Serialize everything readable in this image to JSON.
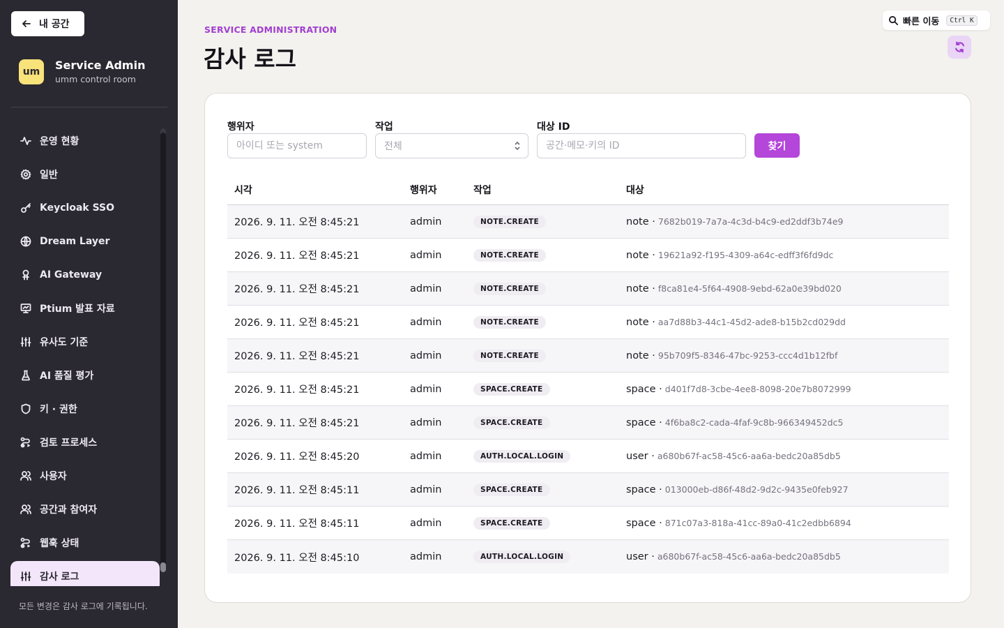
{
  "sidebar": {
    "back_label": "내 공간",
    "brand": {
      "logo": "um",
      "title": "Service Admin",
      "subtitle": "umm control room"
    },
    "items": [
      {
        "label": "운영 현황",
        "icon": "activity-icon"
      },
      {
        "label": "일반",
        "icon": "gear-icon"
      },
      {
        "label": "Keycloak SSO",
        "icon": "key-icon"
      },
      {
        "label": "Dream Layer",
        "icon": "layers-icon"
      },
      {
        "label": "AI Gateway",
        "icon": "gateway-icon"
      },
      {
        "label": "Ptium 발표 자료",
        "icon": "presentation-icon"
      },
      {
        "label": "유사도 기준",
        "icon": "sliders-icon"
      },
      {
        "label": "AI 품질 평가",
        "icon": "flask-icon"
      },
      {
        "label": "키 · 권한",
        "icon": "shield-icon"
      },
      {
        "label": "검토 프로세스",
        "icon": "workflow-icon"
      },
      {
        "label": "사용자",
        "icon": "users-icon"
      },
      {
        "label": "공간과 참여자",
        "icon": "users-icon"
      },
      {
        "label": "웹훅 상태",
        "icon": "webhook-icon"
      },
      {
        "label": "감사 로그",
        "icon": "sliders-icon",
        "active": true
      }
    ],
    "footer": "모든 변경은 감사 로그에 기록됩니다."
  },
  "header": {
    "eyebrow": "SERVICE ADMINISTRATION",
    "title": "감사 로그",
    "quick_nav": {
      "label": "빠른 이동",
      "shortcut": "Ctrl K"
    }
  },
  "filters": {
    "actor": {
      "label": "행위자",
      "placeholder": "아이디 또는 system"
    },
    "action": {
      "label": "작업",
      "value": "전체"
    },
    "target": {
      "label": "대상 ID",
      "placeholder": "공간·메모·키의 ID"
    },
    "search_label": "찾기"
  },
  "table": {
    "headers": {
      "time": "시각",
      "actor": "행위자",
      "action": "작업",
      "target": "대상"
    },
    "rows": [
      {
        "time": "2026. 9. 11. 오전 8:45:21",
        "actor": "admin",
        "action": "NOTE.CREATE",
        "kind": "note ·",
        "id": "7682b019-7a7a-4c3d-b4c9-ed2ddf3b74e9"
      },
      {
        "time": "2026. 9. 11. 오전 8:45:21",
        "actor": "admin",
        "action": "NOTE.CREATE",
        "kind": "note ·",
        "id": "19621a92-f195-4309-a64c-edff3f6fd9dc"
      },
      {
        "time": "2026. 9. 11. 오전 8:45:21",
        "actor": "admin",
        "action": "NOTE.CREATE",
        "kind": "note ·",
        "id": "f8ca81e4-5f64-4908-9ebd-62a0e39bd020"
      },
      {
        "time": "2026. 9. 11. 오전 8:45:21",
        "actor": "admin",
        "action": "NOTE.CREATE",
        "kind": "note ·",
        "id": "aa7d88b3-44c1-45d2-ade8-b15b2cd029dd"
      },
      {
        "time": "2026. 9. 11. 오전 8:45:21",
        "actor": "admin",
        "action": "NOTE.CREATE",
        "kind": "note ·",
        "id": "95b709f5-8346-47bc-9253-ccc4d1b12fbf"
      },
      {
        "time": "2026. 9. 11. 오전 8:45:21",
        "actor": "admin",
        "action": "SPACE.CREATE",
        "kind": "space ·",
        "id": "d401f7d8-3cbe-4ee8-8098-20e7b8072999"
      },
      {
        "time": "2026. 9. 11. 오전 8:45:21",
        "actor": "admin",
        "action": "SPACE.CREATE",
        "kind": "space ·",
        "id": "4f6ba8c2-cada-4faf-9c8b-966349452dc5"
      },
      {
        "time": "2026. 9. 11. 오전 8:45:20",
        "actor": "admin",
        "action": "AUTH.LOCAL.LOGIN",
        "kind": "user ·",
        "id": "a680b67f-ac58-45c6-aa6a-bedc20a85db5"
      },
      {
        "time": "2026. 9. 11. 오전 8:45:11",
        "actor": "admin",
        "action": "SPACE.CREATE",
        "kind": "space ·",
        "id": "013000eb-d86f-48d2-9d2c-9435e0feb927"
      },
      {
        "time": "2026. 9. 11. 오전 8:45:11",
        "actor": "admin",
        "action": "SPACE.CREATE",
        "kind": "space ·",
        "id": "871c07a3-818a-41cc-89a0-41c2edbb6894"
      },
      {
        "time": "2026. 9. 11. 오전 8:45:10",
        "actor": "admin",
        "action": "AUTH.LOCAL.LOGIN",
        "kind": "user ·",
        "id": "a680b67f-ac58-45c6-aa6a-bedc20a85db5"
      }
    ]
  },
  "colors": {
    "accent": "#b446d9",
    "sidebar_bg": "#2a2830",
    "page_bg": "#f3f2ee",
    "logo_bg": "#f8e27a"
  }
}
